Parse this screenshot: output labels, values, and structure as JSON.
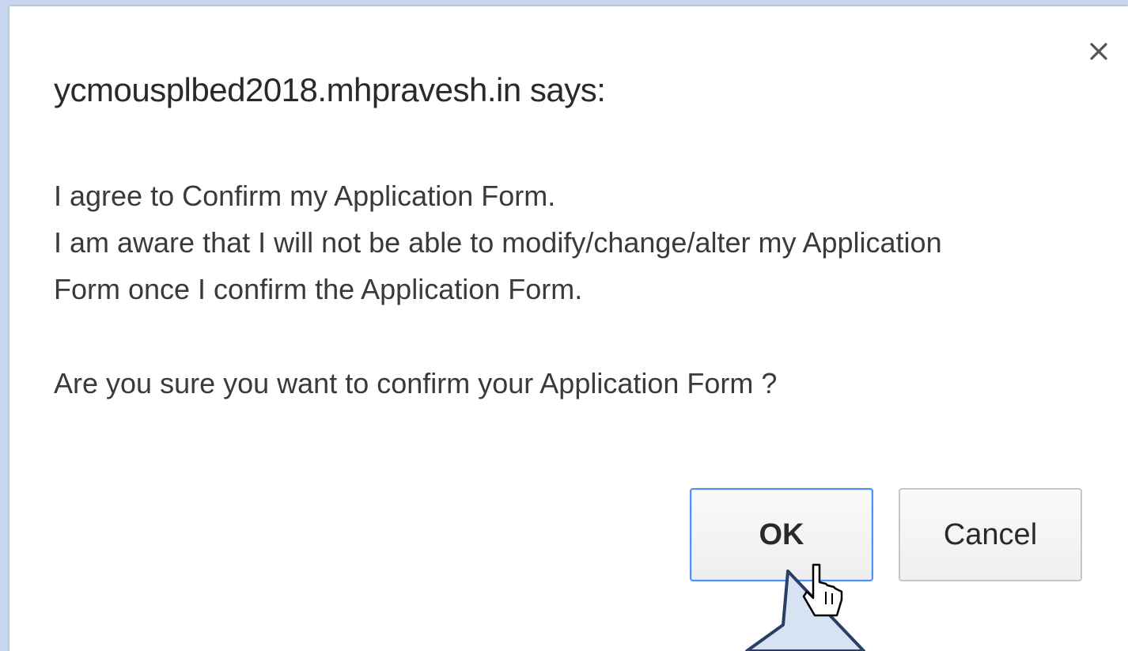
{
  "dialog": {
    "title": "ycmousplbed2018.mhpravesh.in says:",
    "close_icon": "close-icon",
    "message_lines": [
      "I agree to Confirm my Application Form.",
      "I am aware that I will not be able to modify/change/alter my Application",
      "Form once I confirm the Application Form."
    ],
    "question": "Are you sure you want to confirm your Application Form ?",
    "ok_label": "OK",
    "cancel_label": "Cancel"
  },
  "colors": {
    "background": "#c5d5ec",
    "dialog_bg": "#ffffff",
    "ok_border": "#4d90fe",
    "arrow_fill": "#d7e2f2",
    "arrow_stroke": "#2b3e66"
  },
  "icons": {
    "cursor": "hand-pointer-icon",
    "callout": "arrow-callout-icon"
  }
}
